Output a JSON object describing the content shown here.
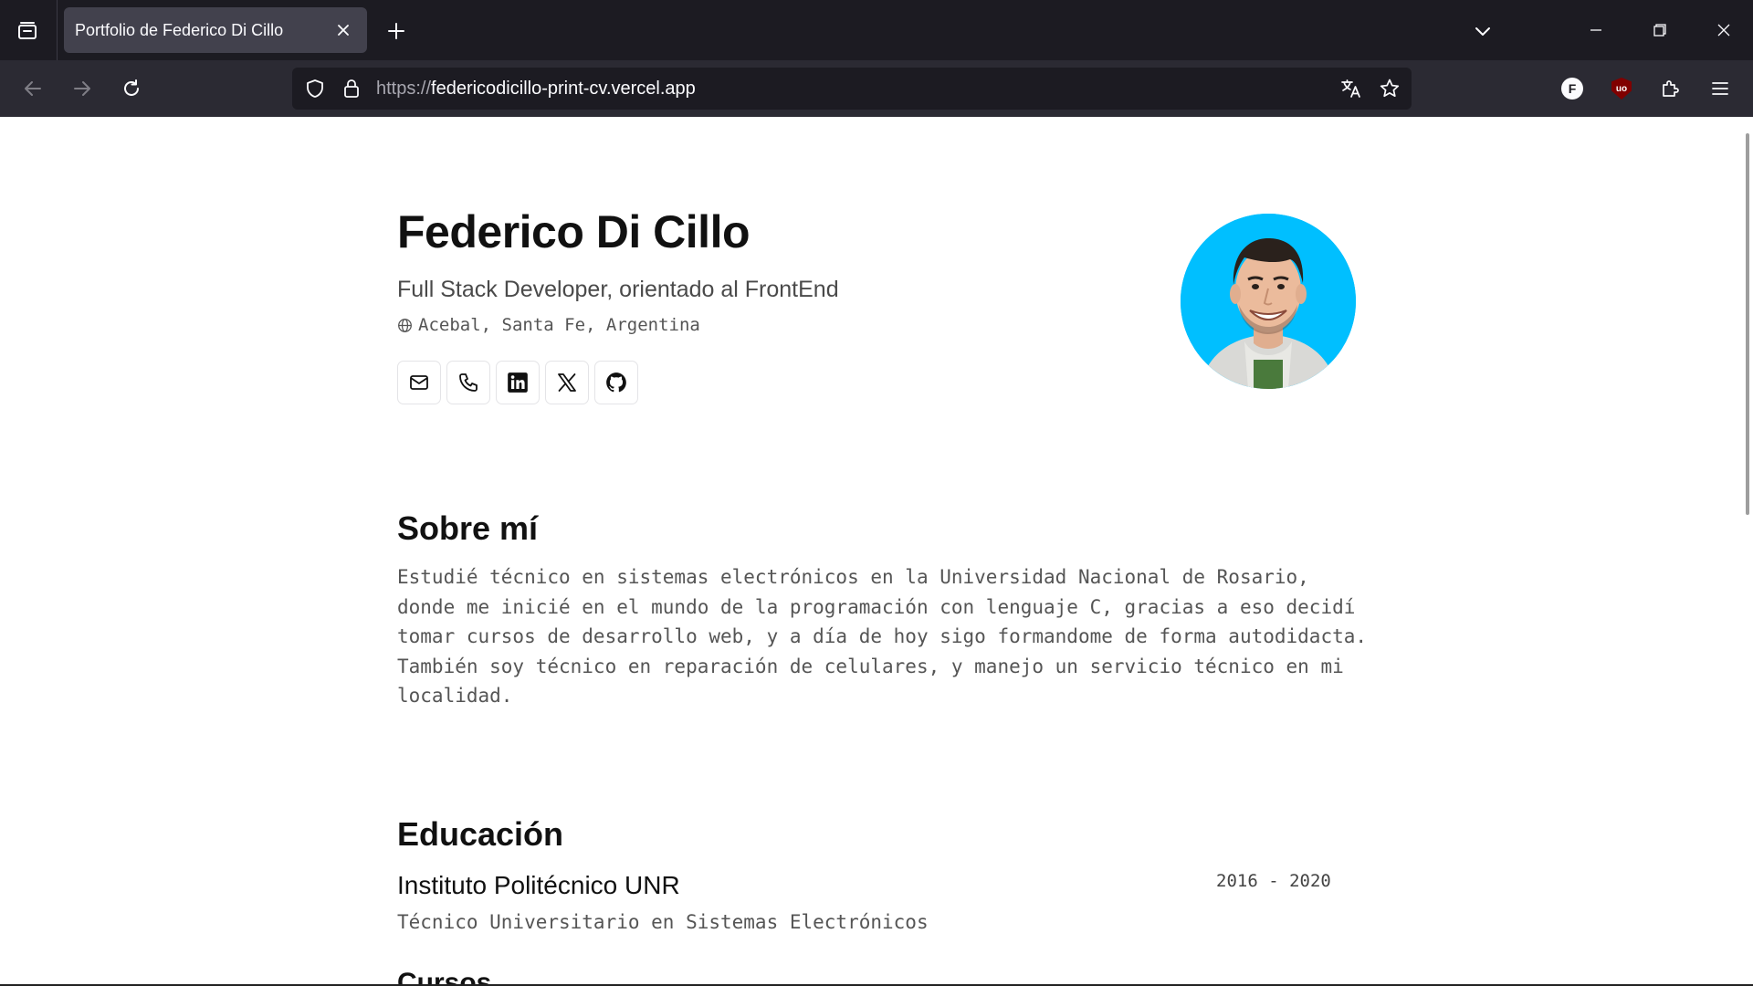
{
  "browser": {
    "tab_title": "Portfolio de Federico Di Cillo",
    "url_scheme": "https://",
    "url_host": "federicodicillo-print-cv.vercel.app",
    "profile_initial": "F",
    "ublock_label": "uo"
  },
  "profile": {
    "name": "Federico Di Cillo",
    "role": "Full Stack Developer, orientado al FrontEnd",
    "location": "Acebal, Santa Fe, Argentina",
    "social": [
      "mail-icon",
      "phone-icon",
      "linkedin-icon",
      "x-icon",
      "github-icon"
    ]
  },
  "about": {
    "title": "Sobre mí",
    "text": "Estudié técnico en sistemas electrónicos en la Universidad Nacional de Rosario, donde me inicié en el mundo de la programación con lenguaje C, gracias a eso decidí tomar cursos de desarrollo web, y a día de hoy sigo formandome de forma autodidacta. También soy técnico en reparación de celulares, y manejo un servicio técnico en mi localidad."
  },
  "education": {
    "title": "Educación",
    "school": "Instituto Politécnico UNR",
    "years": "2016 - 2020",
    "degree": "Técnico Universitario en Sistemas Electrónicos",
    "courses_title": "Cursos"
  },
  "colors": {
    "chrome_dark": "#1c1b22",
    "chrome_toolbar": "#2b2a33",
    "tab_active": "#42414d",
    "avatar_bg": "#00bfff"
  }
}
